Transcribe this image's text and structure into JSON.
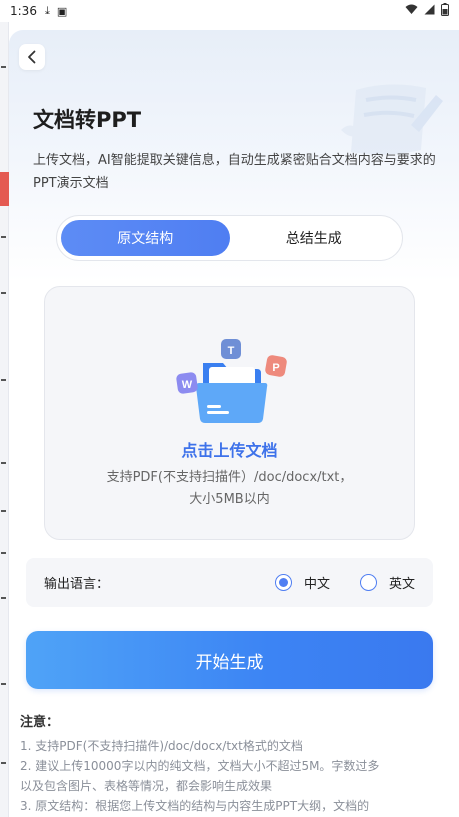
{
  "status_bar": {
    "time": "1:36"
  },
  "page": {
    "title": "文档转PPT",
    "description": "上传文档，AI智能提取关键信息，自动生成紧密贴合文档内容与要求的PPT演示文档"
  },
  "tabs": [
    {
      "label": "原文结构",
      "active": true
    },
    {
      "label": "总结生成",
      "active": false
    }
  ],
  "upload": {
    "badges": [
      "W",
      "T",
      "P"
    ],
    "link_text": "点击上传文档",
    "hint_line1": "支持PDF(不支持扫描件）/doc/docx/txt，",
    "hint_line2": "大小5MB以内"
  },
  "language": {
    "label": "输出语言：",
    "options": [
      {
        "label": "中文",
        "selected": true
      },
      {
        "label": "英文",
        "selected": false
      }
    ]
  },
  "start_button": {
    "label": "开始生成"
  },
  "notes": {
    "title": "注意：",
    "lines": [
      "1. 支持PDF(不支持扫描件)/doc/docx/txt格式的文档",
      "2. 建议上传10000字以内的纯文档，文档大小不超过5M。字数过多",
      "以及包含图片、表格等情况，都会影响生成效果",
      "3. 原文结构：根据您上传文档的结构与内容生成PPT大纲，文档的"
    ]
  },
  "colors": {
    "accent": "#4f7ef2",
    "button_gradient_start": "#4fa3f7",
    "button_gradient_end": "#3a79ef",
    "badge_w": "#8c8bf0",
    "badge_t": "#6f8fd6",
    "badge_p": "#ee8a7d"
  }
}
